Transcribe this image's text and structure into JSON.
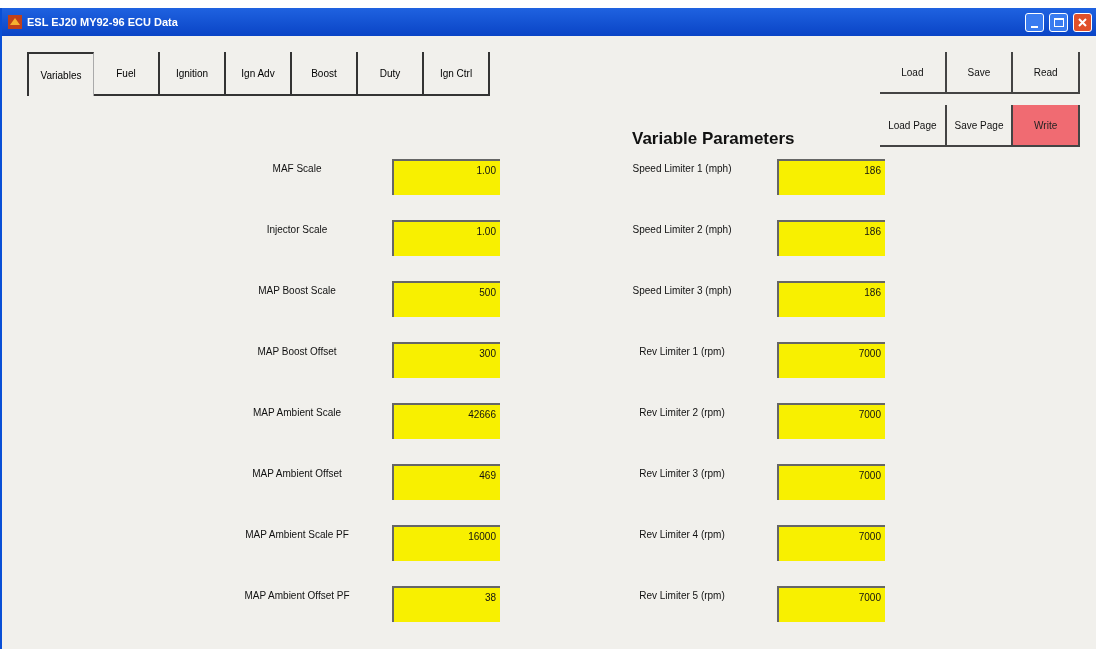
{
  "window": {
    "title": "ESL EJ20 MY92-96 ECU Data"
  },
  "tabs": [
    {
      "label": "Variables",
      "selected": true
    },
    {
      "label": "Fuel",
      "selected": false
    },
    {
      "label": "Ignition",
      "selected": false
    },
    {
      "label": "Ign Adv",
      "selected": false
    },
    {
      "label": "Boost",
      "selected": false
    },
    {
      "label": "Duty",
      "selected": false
    },
    {
      "label": "Ign Ctrl",
      "selected": false
    }
  ],
  "buttons": [
    {
      "label": "Load",
      "kind": "normal"
    },
    {
      "label": "Save",
      "kind": "normal"
    },
    {
      "label": "Read",
      "kind": "normal"
    },
    {
      "label": "Load Page",
      "kind": "normal"
    },
    {
      "label": "Save Page",
      "kind": "normal"
    },
    {
      "label": "Write",
      "kind": "danger"
    }
  ],
  "heading": "Variable Parameters",
  "left_fields": [
    {
      "label": "MAF Scale",
      "value": "1.00"
    },
    {
      "label": "Injector Scale",
      "value": "1.00"
    },
    {
      "label": "MAP Boost Scale",
      "value": "500"
    },
    {
      "label": "MAP Boost Offset",
      "value": "300"
    },
    {
      "label": "MAP Ambient Scale",
      "value": "42666"
    },
    {
      "label": "MAP Ambient Offset",
      "value": "469"
    },
    {
      "label": "MAP Ambient Scale PF",
      "value": "16000"
    },
    {
      "label": "MAP Ambient Offset PF",
      "value": "38"
    }
  ],
  "right_fields": [
    {
      "label": "Speed Limiter 1 (mph)",
      "value": "186"
    },
    {
      "label": "Speed Limiter 2 (mph)",
      "value": "186"
    },
    {
      "label": "Speed Limiter 3 (mph)",
      "value": "186"
    },
    {
      "label": "Rev Limiter 1 (rpm)",
      "value": "7000"
    },
    {
      "label": "Rev Limiter 2 (rpm)",
      "value": "7000"
    },
    {
      "label": "Rev Limiter 3 (rpm)",
      "value": "7000"
    },
    {
      "label": "Rev Limiter 4 (rpm)",
      "value": "7000"
    },
    {
      "label": "Rev Limiter 5 (rpm)",
      "value": "7000"
    }
  ]
}
